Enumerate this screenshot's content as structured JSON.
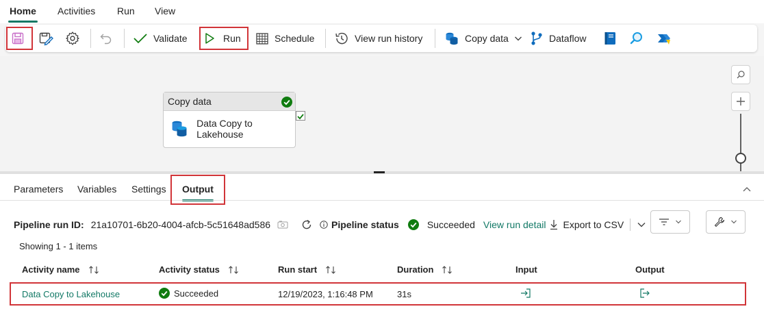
{
  "menu": {
    "tabs": [
      "Home",
      "Activities",
      "Run",
      "View"
    ]
  },
  "toolbar": {
    "validate": "Validate",
    "run": "Run",
    "schedule": "Schedule",
    "view_run_history": "View run history",
    "copy_data": "Copy data",
    "dataflow": "Dataflow"
  },
  "canvas": {
    "node": {
      "type": "Copy data",
      "name": "Data Copy to Lakehouse"
    }
  },
  "panel": {
    "tabs": [
      "Parameters",
      "Variables",
      "Settings",
      "Output"
    ],
    "run_id_label": "Pipeline run ID:",
    "run_id": "21a10701-6b20-4004-afcb-5c51648ad586",
    "status_label": "Pipeline status",
    "status_value": "Succeeded",
    "view_run_detail": "View run detail",
    "export_csv": "Export to CSV",
    "showing": "Showing 1 - 1 items"
  },
  "table": {
    "columns": [
      "Activity name",
      "Activity status",
      "Run start",
      "Duration",
      "Input",
      "Output"
    ],
    "rows": [
      {
        "activity_name": "Data Copy to Lakehouse",
        "status": "Succeeded",
        "run_start": "12/19/2023, 1:16:48 PM",
        "duration": "31s"
      }
    ]
  },
  "colors": {
    "accent": "#117865",
    "highlight": "#d13438",
    "success": "#107c10"
  }
}
